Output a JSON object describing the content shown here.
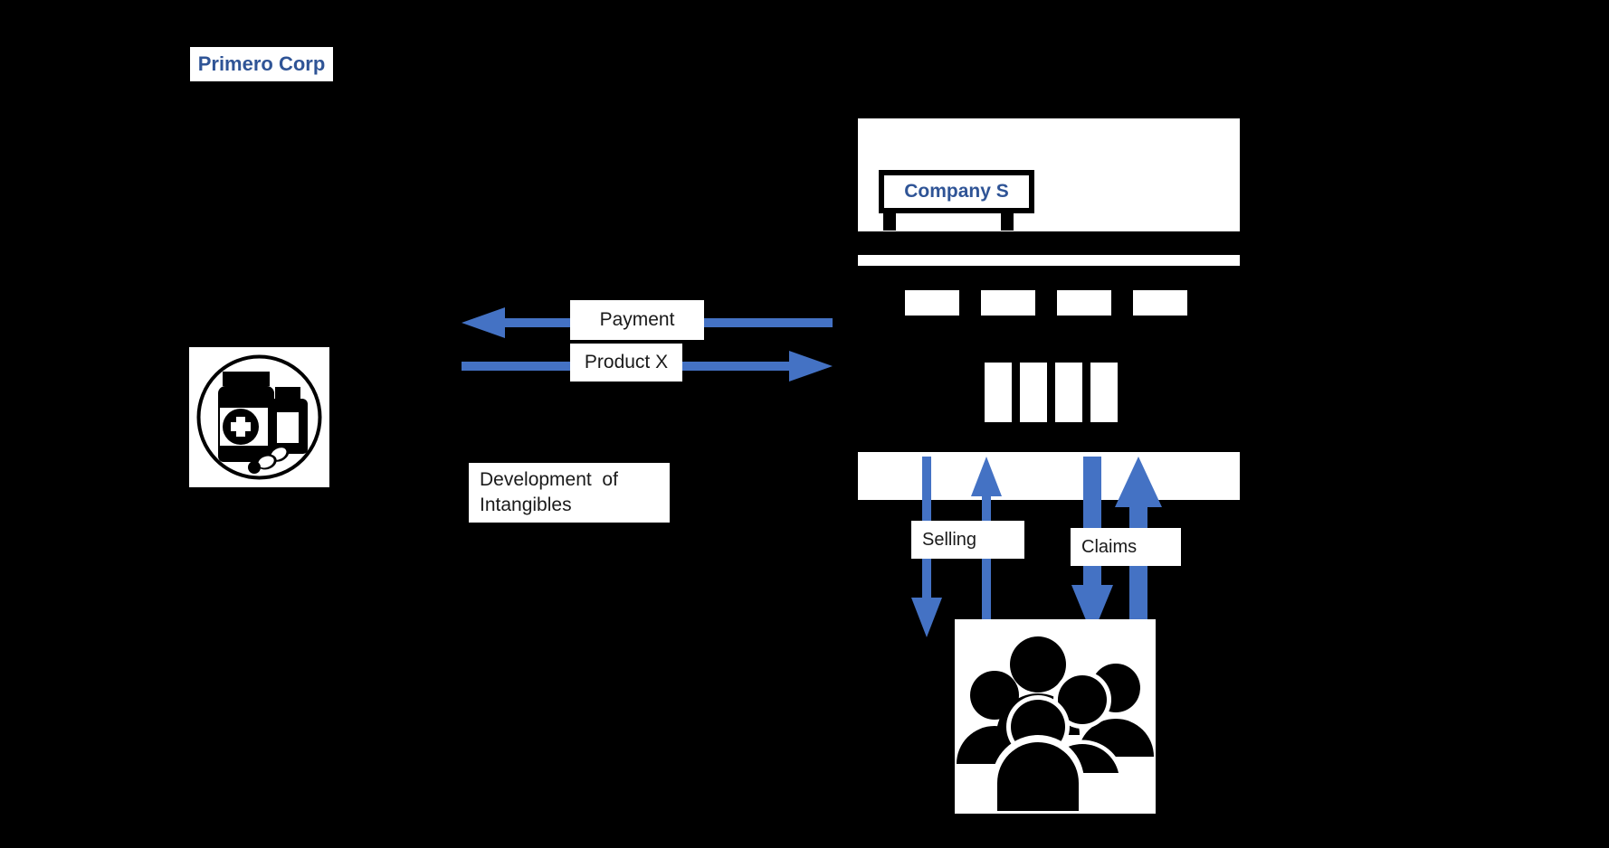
{
  "diagram": {
    "background_color": "#000000",
    "accent_color": "#4472C4",
    "title_text_color": "#2F5496",
    "label_text_color": "#1a1a1a",
    "entities": {
      "primero_corp": {
        "label": "Primero Corp",
        "icon": "pharmaceutical-bottles-icon"
      },
      "company_s": {
        "label": "Company S",
        "icon": "storefront-icon"
      },
      "customers": {
        "icon": "group-of-people-icon"
      }
    },
    "flows": [
      {
        "name": "payment",
        "label": "Payment",
        "direction": "left",
        "style": "thin"
      },
      {
        "name": "product_x",
        "label": "Product X",
        "direction": "right",
        "style": "thin"
      },
      {
        "name": "development",
        "label": "Development of\nIntangibles",
        "direction": "none",
        "style": "none"
      },
      {
        "name": "selling_out",
        "label": "Selling",
        "direction": "down",
        "style": "thin"
      },
      {
        "name": "selling_in",
        "label": "",
        "direction": "up",
        "style": "thin"
      },
      {
        "name": "claims_down",
        "label": "Claims",
        "direction": "down",
        "style": "thick"
      },
      {
        "name": "claims_up",
        "label": "",
        "direction": "up",
        "style": "thick"
      }
    ],
    "labels": {
      "payment": "Payment",
      "product_x": "Product X",
      "development_line1": "Development  of",
      "development_line2": "Intangibles",
      "selling": "Selling",
      "claims": "Claims"
    }
  }
}
